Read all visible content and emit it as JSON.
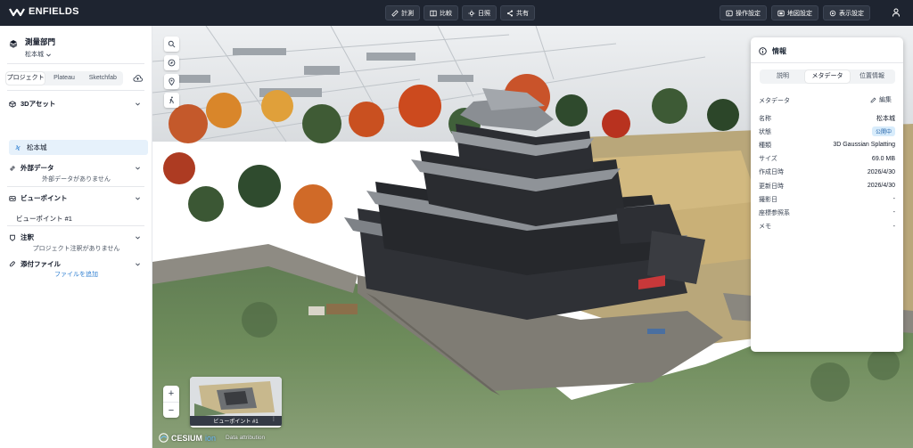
{
  "app": {
    "brand": "ENFIELDS"
  },
  "toolbar": {
    "center": [
      {
        "label": "計測",
        "icon": "ruler-icon"
      },
      {
        "label": "比較",
        "icon": "compare-icon"
      },
      {
        "label": "日照",
        "icon": "sun-icon"
      },
      {
        "label": "共有",
        "icon": "share-icon"
      }
    ],
    "right": [
      {
        "label": "操作設定",
        "icon": "control-settings-icon"
      },
      {
        "label": "地図設定",
        "icon": "map-settings-icon"
      },
      {
        "label": "表示設定",
        "icon": "display-settings-icon"
      }
    ]
  },
  "sidebar": {
    "project_title": "測量部門",
    "project_sub": "松本城",
    "tabs": [
      "プロジェクト",
      "Plateau",
      "Sketchfab"
    ],
    "active_tab": 0,
    "sections": {
      "assets": {
        "label": "3Dアセット",
        "items": [
          "松本城"
        ]
      },
      "external": {
        "label": "外部データ",
        "empty": "外部データがありません"
      },
      "viewpoints": {
        "label": "ビューポイント",
        "items": [
          "ビューポイント #1"
        ]
      },
      "notes": {
        "label": "注釈",
        "empty": "プロジェクト注釈がありません"
      },
      "attachments": {
        "label": "添付ファイル",
        "add": "ファイルを追加"
      }
    }
  },
  "viewer": {
    "thumbnail_label": "ビューポイント #1",
    "thumbnail_menu": "⋮",
    "cesium_brand": "CESIUM",
    "cesium_ion": "ion",
    "cesium_attr": "Data attribution",
    "zoom_in": "+",
    "zoom_out": "−"
  },
  "panel": {
    "title": "情報",
    "tabs": [
      "説明",
      "メタデータ",
      "位置情報"
    ],
    "active_tab": 1,
    "meta_heading": "メタデータ",
    "edit_label": "編集",
    "rows": [
      {
        "k": "名称",
        "v": "松本城"
      },
      {
        "k": "状態",
        "v": "公開中"
      },
      {
        "k": "種類",
        "v": "3D Gaussian Splatting"
      },
      {
        "k": "サイズ",
        "v": "69.0 MB"
      },
      {
        "k": "作成日時",
        "v": "2026/4/30"
      },
      {
        "k": "更新日時",
        "v": "2026/4/30"
      },
      {
        "k": "撮影日",
        "v": "-"
      },
      {
        "k": "座標参照系",
        "v": "-"
      },
      {
        "k": "メモ",
        "v": "-"
      }
    ]
  },
  "colors": {
    "topbar": "#1e2430",
    "accent": "#2f7fd1",
    "selected_bg": "#e6f1fb",
    "badge_bg": "#d8ecfb"
  }
}
